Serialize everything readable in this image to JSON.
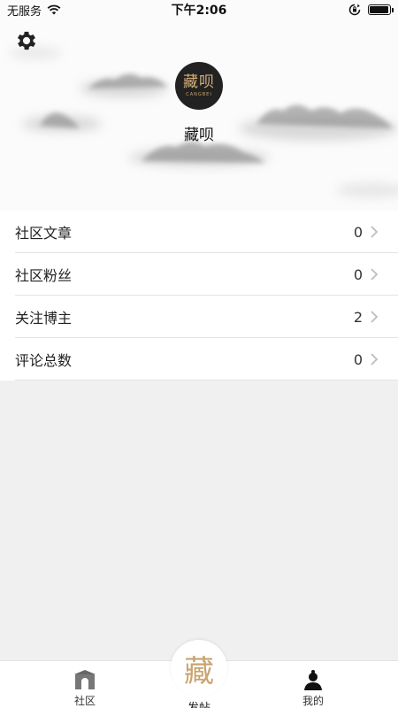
{
  "status_bar": {
    "carrier": "无服务",
    "time": "下午2:06",
    "battery_level": 0.95
  },
  "header": {
    "logo_text": "藏呗",
    "logo_subtext": "CANGBEI",
    "username": "藏呗"
  },
  "stats": [
    {
      "label": "社区文章",
      "value": "0"
    },
    {
      "label": "社区粉丝",
      "value": "0"
    },
    {
      "label": "关注博主",
      "value": "2"
    },
    {
      "label": "评论总数",
      "value": "0"
    }
  ],
  "tabbar": {
    "community": "社区",
    "post": "发帖",
    "post_glyph": "藏",
    "mine": "我的"
  },
  "colors": {
    "accent_gold": "#c9a46e",
    "list_background": "#ffffff",
    "page_background": "#f0f0f0"
  }
}
